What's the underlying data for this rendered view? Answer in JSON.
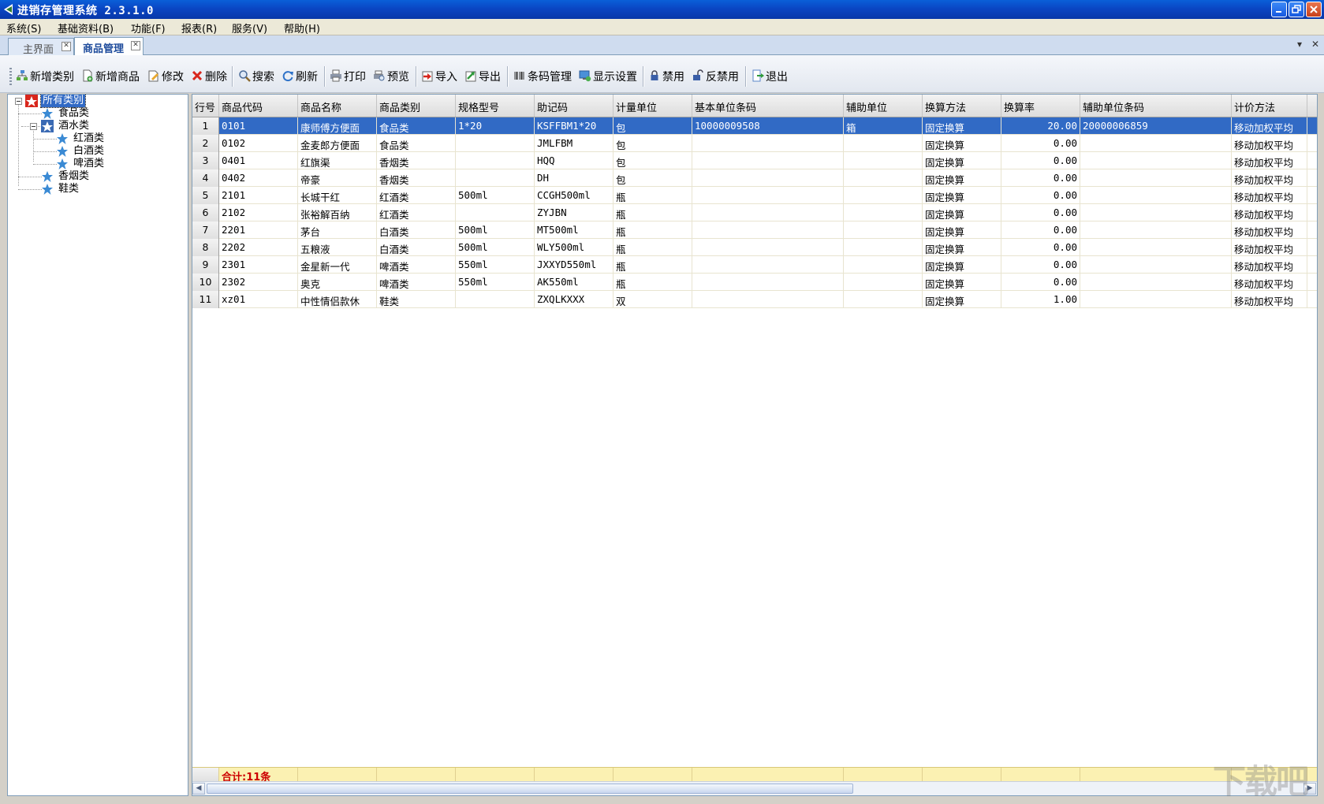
{
  "window": {
    "title": "进销存管理系统 2.3.1.0"
  },
  "menu": [
    {
      "label": "系统(S)"
    },
    {
      "label": "基础资料(B)"
    },
    {
      "label": "功能(F)"
    },
    {
      "label": "报表(R)"
    },
    {
      "label": "服务(V)"
    },
    {
      "label": "帮助(H)"
    }
  ],
  "tabs": [
    {
      "label": "主界面",
      "active": false
    },
    {
      "label": "商品管理",
      "active": true
    }
  ],
  "toolbar": [
    {
      "label": "新增类别",
      "icon": "add-category-icon"
    },
    {
      "label": "新增商品",
      "icon": "add-product-icon"
    },
    {
      "label": "修改",
      "icon": "edit-icon"
    },
    {
      "label": "删除",
      "icon": "delete-icon"
    },
    {
      "label": "搜索",
      "icon": "search-icon"
    },
    {
      "label": "刷新",
      "icon": "refresh-icon"
    },
    {
      "label": "打印",
      "icon": "print-icon"
    },
    {
      "label": "预览",
      "icon": "preview-icon"
    },
    {
      "label": "导入",
      "icon": "import-icon"
    },
    {
      "label": "导出",
      "icon": "export-icon"
    },
    {
      "label": "条码管理",
      "icon": "barcode-icon"
    },
    {
      "label": "显示设置",
      "icon": "display-settings-icon"
    },
    {
      "label": "禁用",
      "icon": "lock-icon"
    },
    {
      "label": "反禁用",
      "icon": "unlock-icon"
    },
    {
      "label": "退出",
      "icon": "exit-icon"
    }
  ],
  "tree": {
    "root": "所有类别",
    "nodes": [
      "食品类",
      "酒水类",
      "红酒类",
      "白酒类",
      "啤酒类",
      "香烟类",
      "鞋类"
    ]
  },
  "grid": {
    "columns": [
      "行号",
      "商品代码",
      "商品名称",
      "商品类别",
      "规格型号",
      "助记码",
      "计量单位",
      "基本单位条码",
      "辅助单位",
      "换算方法",
      "换算率",
      "辅助单位条码",
      "计价方法"
    ],
    "rows": [
      [
        "1",
        "0101",
        "康师傅方便面",
        "食品类",
        "1*20",
        "KSFFBM1*20",
        "包",
        "10000009508",
        "箱",
        "固定换算",
        "20.00",
        "20000006859",
        "移动加权平均"
      ],
      [
        "2",
        "0102",
        "金麦郎方便面",
        "食品类",
        "",
        "JMLFBM",
        "包",
        "",
        "",
        "固定换算",
        "0.00",
        "",
        "移动加权平均"
      ],
      [
        "3",
        "0401",
        "红旗渠",
        "香烟类",
        "",
        "HQQ",
        "包",
        "",
        "",
        "固定换算",
        "0.00",
        "",
        "移动加权平均"
      ],
      [
        "4",
        "0402",
        "帝豪",
        "香烟类",
        "",
        "DH",
        "包",
        "",
        "",
        "固定换算",
        "0.00",
        "",
        "移动加权平均"
      ],
      [
        "5",
        "2101",
        "长城干红",
        "红酒类",
        "500ml",
        "CCGH500ml",
        "瓶",
        "",
        "",
        "固定换算",
        "0.00",
        "",
        "移动加权平均"
      ],
      [
        "6",
        "2102",
        "张裕解百纳",
        "红酒类",
        "",
        "ZYJBN",
        "瓶",
        "",
        "",
        "固定换算",
        "0.00",
        "",
        "移动加权平均"
      ],
      [
        "7",
        "2201",
        "茅台",
        "白酒类",
        "500ml",
        "MT500ml",
        "瓶",
        "",
        "",
        "固定换算",
        "0.00",
        "",
        "移动加权平均"
      ],
      [
        "8",
        "2202",
        "五粮液",
        "白酒类",
        "500ml",
        "WLY500ml",
        "瓶",
        "",
        "",
        "固定换算",
        "0.00",
        "",
        "移动加权平均"
      ],
      [
        "9",
        "2301",
        "金星新一代",
        "啤酒类",
        "550ml",
        "JXXYD550ml",
        "瓶",
        "",
        "",
        "固定换算",
        "0.00",
        "",
        "移动加权平均"
      ],
      [
        "10",
        "2302",
        "奥克",
        "啤酒类",
        "550ml",
        "AK550ml",
        "瓶",
        "",
        "",
        "固定换算",
        "0.00",
        "",
        "移动加权平均"
      ],
      [
        "11",
        "xz01",
        "中性情侣款休",
        "鞋类",
        "",
        "ZXQLKXXX",
        "双",
        "",
        "",
        "固定换算",
        "1.00",
        "",
        "移动加权平均"
      ]
    ],
    "selected_row": 0,
    "summary": "合计:11条"
  },
  "watermark": "下载吧"
}
